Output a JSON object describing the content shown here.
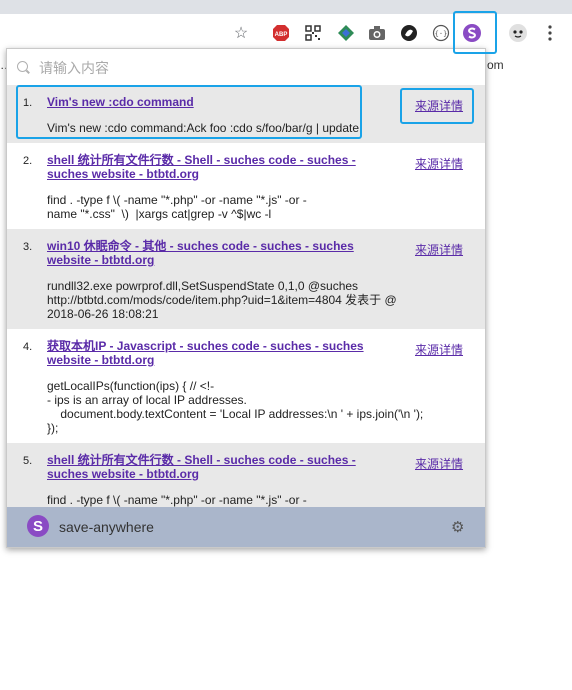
{
  "toolbar": {
    "icons": [
      "star-icon",
      "adblock-icon",
      "qr-code-icon",
      "extension-icon",
      "camera-icon",
      "extension-circle-icon",
      "code-braces-icon",
      "save-anywhere-icon",
      "extension-face-icon",
      "more-vert-icon"
    ],
    "adblock_label": "ABP"
  },
  "bookmarks": {
    "left_fragment": "…",
    "right_fragment": "om"
  },
  "search": {
    "placeholder": "请输入内容",
    "value": ""
  },
  "results": [
    {
      "num": "1.",
      "title": "Vim's new :cdo command",
      "desc": "Vim's new :cdo command:Ack foo :cdo s/foo/bar/g | update",
      "source": "来源详情"
    },
    {
      "num": "2.",
      "title": "shell 统计所有文件行数 - Shell - suches code - suches - suches website - btbtd.org",
      "desc": "find . -type f \\( -name \"*.php\" -or -name \"*.js\" -or -\nname \"*.css\"  \\)  |xargs cat|grep -v ^$|wc -l",
      "source": "来源详情"
    },
    {
      "num": "3.",
      "title": "win10 休眠命令 - 其他 - suches code - suches - suches website - btbtd.org",
      "desc": "rundll32.exe powrprof.dll,SetSuspendState 0,1,0 @suches\nhttp://btbtd.com/mods/code/item.php?uid=1&item=4804 发表于 @\n2018-06-26 18:08:21",
      "source": "来源详情"
    },
    {
      "num": "4.",
      "title": "获取本机IP - Javascript - suches code - suches - suches website - btbtd.org",
      "desc": "getLocalIPs(function(ips) { // <!-\n- ips is an array of local IP addresses.\n    document.body.textContent = 'Local IP addresses:\\n ' + ips.join('\\n ');\n});",
      "source": "来源详情"
    },
    {
      "num": "5.",
      "title": "shell 统计所有文件行数 - Shell - suches code - suches - suches website - btbtd.org",
      "desc": "find . -type f \\( -name \"*.php\" -or -name \"*.js\" -or -\nname \"*.css\"  \\)  |xargs cat|grep -v ^$|wc -l",
      "source": "来源详情"
    }
  ],
  "footer": {
    "logo_letter": "S",
    "label": "save-anywhere",
    "gear_icon": "gear-icon"
  },
  "colors": {
    "accent": "#5a2ba8",
    "highlight": "#1aa3e8",
    "footer_bg": "#aab6cb",
    "logo": "#8a4bc4"
  }
}
